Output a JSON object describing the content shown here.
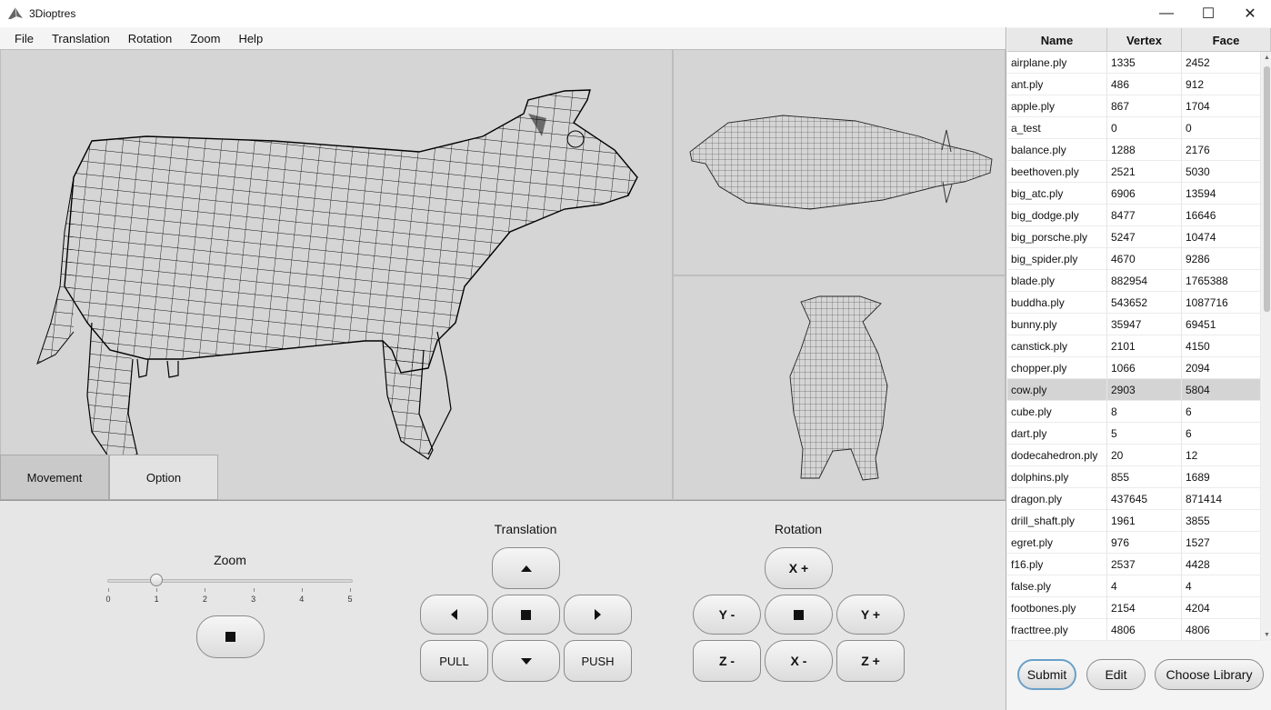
{
  "window": {
    "title": "3Dioptres",
    "minimize": "—",
    "maximize": "☐",
    "close": "✕"
  },
  "menu": [
    "File",
    "Translation",
    "Rotation",
    "Zoom",
    "Help"
  ],
  "tabs": {
    "movement": "Movement",
    "option": "Option"
  },
  "zoom": {
    "label": "Zoom",
    "ticks": [
      "0",
      "1",
      "2",
      "3",
      "4",
      "5"
    ],
    "value": 1,
    "min": 0,
    "max": 5,
    "stop_icon": "stop-icon"
  },
  "translation": {
    "label": "Translation",
    "pull": "PULL",
    "push": "PUSH"
  },
  "rotation": {
    "label": "Rotation",
    "x_plus": "X +",
    "x_minus": "X -",
    "y_plus": "Y +",
    "y_minus": "Y -",
    "z_plus": "Z +",
    "z_minus": "Z -"
  },
  "table": {
    "headers": [
      "Name",
      "Vertex",
      "Face"
    ],
    "selected": "cow.ply",
    "rows": [
      [
        "airplane.ply",
        "1335",
        "2452"
      ],
      [
        "ant.ply",
        "486",
        "912"
      ],
      [
        "apple.ply",
        "867",
        "1704"
      ],
      [
        "a_test",
        "0",
        "0"
      ],
      [
        "balance.ply",
        "1288",
        "2176"
      ],
      [
        "beethoven.ply",
        "2521",
        "5030"
      ],
      [
        "big_atc.ply",
        "6906",
        "13594"
      ],
      [
        "big_dodge.ply",
        "8477",
        "16646"
      ],
      [
        "big_porsche.ply",
        "5247",
        "10474"
      ],
      [
        "big_spider.ply",
        "4670",
        "9286"
      ],
      [
        "blade.ply",
        "882954",
        "1765388"
      ],
      [
        "buddha.ply",
        "543652",
        "1087716"
      ],
      [
        "bunny.ply",
        "35947",
        "69451"
      ],
      [
        "canstick.ply",
        "2101",
        "4150"
      ],
      [
        "chopper.ply",
        "1066",
        "2094"
      ],
      [
        "cow.ply",
        "2903",
        "5804"
      ],
      [
        "cube.ply",
        "8",
        "6"
      ],
      [
        "dart.ply",
        "5",
        "6"
      ],
      [
        "dodecahedron.ply",
        "20",
        "12"
      ],
      [
        "dolphins.ply",
        "855",
        "1689"
      ],
      [
        "dragon.ply",
        "437645",
        "871414"
      ],
      [
        "drill_shaft.ply",
        "1961",
        "3855"
      ],
      [
        "egret.ply",
        "976",
        "1527"
      ],
      [
        "f16.ply",
        "2537",
        "4428"
      ],
      [
        "false.ply",
        "4",
        "4"
      ],
      [
        "footbones.ply",
        "2154",
        "4204"
      ],
      [
        "fracttree.ply",
        "4806",
        "4806"
      ]
    ]
  },
  "actions": {
    "submit": "Submit",
    "edit": "Edit",
    "choose_library": "Choose Library"
  }
}
